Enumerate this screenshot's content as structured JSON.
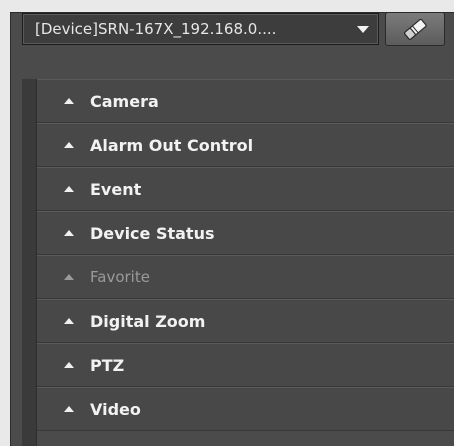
{
  "device_selector": {
    "value": "[Device]SRN-167X_192.168.0...."
  },
  "toolbar": {
    "tool_icon": "eraser-icon"
  },
  "panels": [
    {
      "label": "Camera",
      "enabled": true
    },
    {
      "label": "Alarm Out Control",
      "enabled": true
    },
    {
      "label": "Event",
      "enabled": true
    },
    {
      "label": "Device Status",
      "enabled": true
    },
    {
      "label": "Favorite",
      "enabled": false
    },
    {
      "label": "Digital Zoom",
      "enabled": true
    },
    {
      "label": "PTZ",
      "enabled": true
    },
    {
      "label": "Video",
      "enabled": true
    }
  ]
}
